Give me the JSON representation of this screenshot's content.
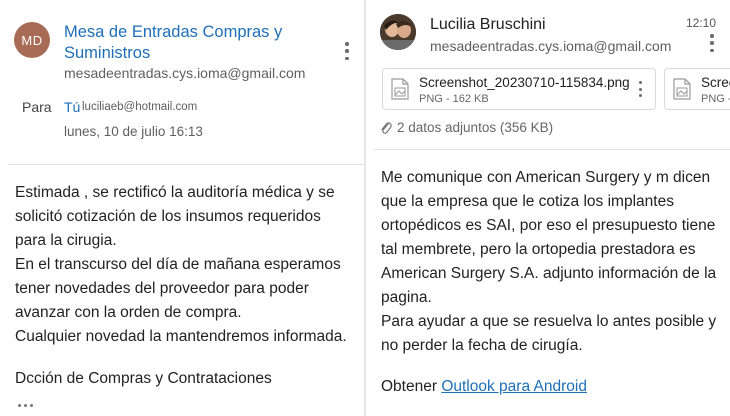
{
  "left_email": {
    "avatar_initials": "MD",
    "sender_name": "Mesa de Entradas Compras y Suministros",
    "sender_email": "mesadeentradas.cys.ioma@gmail.com",
    "to_label": "Para",
    "to_self": "Tú",
    "to_email": "luciliaeb@hotmail.com",
    "date": "lunes, 10 de julio 16:13",
    "body_lines": [
      "Estimada , se rectificó la auditoría médica y se",
      "solicitó cotización de los insumos requeridos",
      "para la cirugia.",
      "En el transcurso del día de mañana esperamos",
      "tener novedades del proveedor para poder",
      "avanzar con la orden de compra.",
      "Cualquier novedad la mantendremos informada."
    ],
    "signature": "Dcción de Compras y Contrataciones"
  },
  "right_email": {
    "sender_name": "Lucilia Bruschini",
    "to_email": "mesadeentradas.cys.ioma@gmail.com",
    "time": "12:10",
    "attachments": [
      {
        "name": "Screenshot_20230710-115834.png",
        "meta": "PNG - 162 KB"
      },
      {
        "name": "Scree",
        "meta": "PNG -"
      }
    ],
    "attachments_summary": "2 datos adjuntos (356 KB)",
    "body_lines": [
      "Me comunique con American Surgery y m dicen",
      "que la empresa que le cotiza los implantes",
      "ortopédicos es SAI, por eso el presupuesto tiene",
      "tal membrete, pero la ortopedia prestadora es",
      "American Surgery S.A. adjunto información de la",
      "pagina.",
      "Para ayudar a que se resuelva lo antes posible y",
      "no perder la fecha de cirugía."
    ],
    "footer_prefix": "Obtener",
    "footer_link": "Outlook para Android"
  },
  "colors": {
    "link_blue": "#1e6fb8",
    "avatar_md": "#a86b55"
  },
  "icons": [
    "more-vert-icon",
    "image-file-icon",
    "paperclip-icon",
    "more-horiz-icon"
  ]
}
